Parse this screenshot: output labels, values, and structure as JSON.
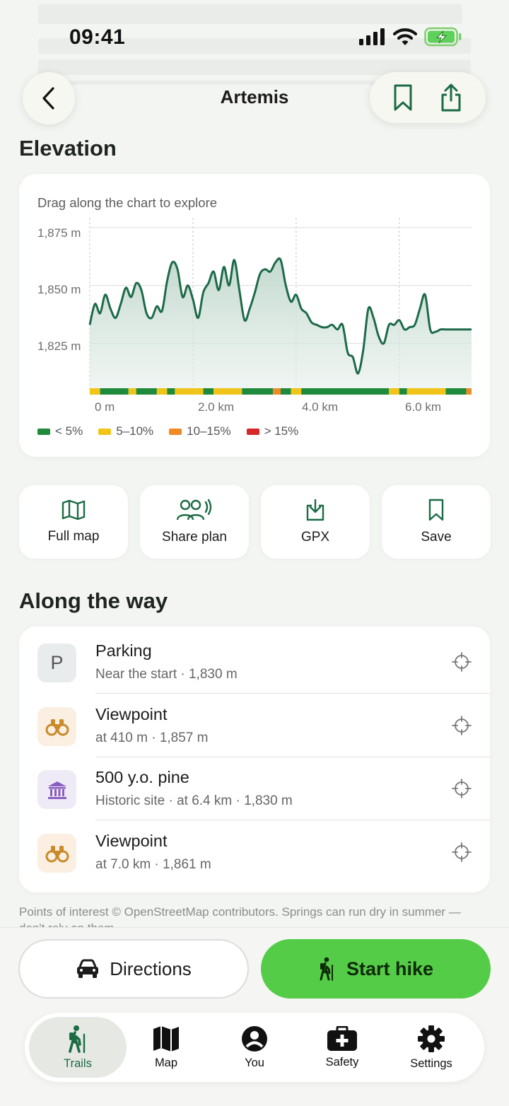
{
  "status": {
    "time": "09:41"
  },
  "nav": {
    "title": "Artemis"
  },
  "elevation": {
    "section_title": "Elevation",
    "hint": "Drag along the chart to explore",
    "legend": [
      {
        "label": "< 5%",
        "color": "#1e8a3c"
      },
      {
        "label": "5–10%",
        "color": "#f0c419"
      },
      {
        "label": "10–15%",
        "color": "#f08a24"
      },
      {
        "label": "> 15%",
        "color": "#d62828"
      }
    ]
  },
  "chart_data": {
    "type": "area",
    "xlabel": "",
    "ylabel": "",
    "x_ticks": [
      "0 m",
      "2.0 km",
      "4.0 km",
      "6.0 km"
    ],
    "y_ticks": [
      "1,875 m",
      "1,850 m",
      "1,825 m"
    ],
    "x_range_km": [
      0,
      7.4
    ],
    "y_range_m": [
      1805,
      1878
    ],
    "series": [
      {
        "x_km": [
          0,
          0.1,
          0.2,
          0.3,
          0.4,
          0.5,
          0.6,
          0.7,
          0.8,
          0.9,
          1.0,
          1.1,
          1.2,
          1.3,
          1.4,
          1.5,
          1.6,
          1.7,
          1.8,
          1.9,
          2.0,
          2.1,
          2.2,
          2.3,
          2.4,
          2.5,
          2.6,
          2.7,
          2.8,
          2.9,
          3.0,
          3.1,
          3.2,
          3.3,
          3.4,
          3.5,
          3.6,
          3.7,
          3.8,
          3.9,
          4.0,
          4.1,
          4.2,
          4.3,
          4.4,
          4.5,
          4.6,
          4.7,
          4.8,
          4.9,
          5.0,
          5.1,
          5.2,
          5.3,
          5.4,
          5.5,
          5.6,
          5.7,
          5.8,
          5.9,
          6.0,
          6.1,
          6.2,
          6.3,
          6.4,
          6.5,
          6.6,
          6.7,
          6.8,
          6.9,
          7.0,
          7.1,
          7.2,
          7.3,
          7.4
        ],
        "elevation_m": [
          1833,
          1842,
          1838,
          1846,
          1840,
          1836,
          1842,
          1849,
          1845,
          1851,
          1848,
          1838,
          1836,
          1841,
          1839,
          1852,
          1860,
          1857,
          1845,
          1850,
          1844,
          1836,
          1847,
          1851,
          1856,
          1848,
          1858,
          1850,
          1861,
          1848,
          1835,
          1840,
          1847,
          1855,
          1857,
          1856,
          1860,
          1861,
          1850,
          1843,
          1846,
          1840,
          1838,
          1834,
          1833,
          1832,
          1832,
          1833,
          1831,
          1833,
          1821,
          1819,
          1812,
          1822,
          1840,
          1836,
          1828,
          1825,
          1833,
          1833,
          1835,
          1831,
          1832,
          1833,
          1840,
          1846,
          1831,
          1830,
          1831,
          1831,
          1831,
          1831,
          1831,
          1831,
          1831
        ]
      }
    ],
    "grade_segments": [
      {
        "from_km": 0.0,
        "to_km": 0.2,
        "class": "5–10%"
      },
      {
        "from_km": 0.2,
        "to_km": 0.75,
        "class": "< 5%"
      },
      {
        "from_km": 0.75,
        "to_km": 0.9,
        "class": "5–10%"
      },
      {
        "from_km": 0.9,
        "to_km": 1.3,
        "class": "< 5%"
      },
      {
        "from_km": 1.3,
        "to_km": 1.5,
        "class": "5–10%"
      },
      {
        "from_km": 1.5,
        "to_km": 1.65,
        "class": "< 5%"
      },
      {
        "from_km": 1.65,
        "to_km": 2.2,
        "class": "5–10%"
      },
      {
        "from_km": 2.2,
        "to_km": 2.4,
        "class": "< 5%"
      },
      {
        "from_km": 2.4,
        "to_km": 2.95,
        "class": "5–10%"
      },
      {
        "from_km": 2.95,
        "to_km": 3.55,
        "class": "< 5%"
      },
      {
        "from_km": 3.55,
        "to_km": 3.7,
        "class": "10–15%"
      },
      {
        "from_km": 3.7,
        "to_km": 3.9,
        "class": "< 5%"
      },
      {
        "from_km": 3.9,
        "to_km": 4.1,
        "class": "5–10%"
      },
      {
        "from_km": 4.1,
        "to_km": 5.8,
        "class": "< 5%"
      },
      {
        "from_km": 5.8,
        "to_km": 6.0,
        "class": "5–10%"
      },
      {
        "from_km": 6.0,
        "to_km": 6.15,
        "class": "< 5%"
      },
      {
        "from_km": 6.15,
        "to_km": 6.9,
        "class": "5–10%"
      },
      {
        "from_km": 6.9,
        "to_km": 7.3,
        "class": "< 5%"
      },
      {
        "from_km": 7.3,
        "to_km": 7.4,
        "class": "10–15%"
      }
    ],
    "line_color": "#1d6a4a",
    "grid": true
  },
  "actions": [
    {
      "label": "Full map",
      "icon": "map-icon"
    },
    {
      "label": "Share plan",
      "icon": "group-share-icon"
    },
    {
      "label": "GPX",
      "icon": "download-icon"
    },
    {
      "label": "Save",
      "icon": "bookmark-icon"
    }
  ],
  "along": {
    "section_title": "Along the way",
    "items": [
      {
        "name": "Parking",
        "sub": "Near the start · 1,830 m",
        "icon": "parking-icon"
      },
      {
        "name": "Viewpoint",
        "sub": "at 410 m · 1,857 m",
        "icon": "binoculars-icon"
      },
      {
        "name": "500 y.o. pine",
        "sub": "Historic site · at 6.4 km · 1,830 m",
        "icon": "historic-site-icon"
      },
      {
        "name": "Viewpoint",
        "sub": "at 7.0 km · 1,861 m",
        "icon": "binoculars-icon"
      }
    ],
    "footnote": "Points of interest © OpenStreetMap contributors. Springs can run dry in summer — don't rely on them."
  },
  "cta": {
    "directions": "Directions",
    "start": "Start hike"
  },
  "tabs": [
    {
      "label": "Trails",
      "icon": "hiker-icon",
      "active": true
    },
    {
      "label": "Map",
      "icon": "map-icon"
    },
    {
      "label": "You",
      "icon": "person-icon"
    },
    {
      "label": "Safety",
      "icon": "first-aid-icon"
    },
    {
      "label": "Settings",
      "icon": "gear-icon"
    }
  ],
  "colors": {
    "accent": "#55cc47",
    "brand_dark": "#1b6b43",
    "background": "#f3f5f2"
  }
}
